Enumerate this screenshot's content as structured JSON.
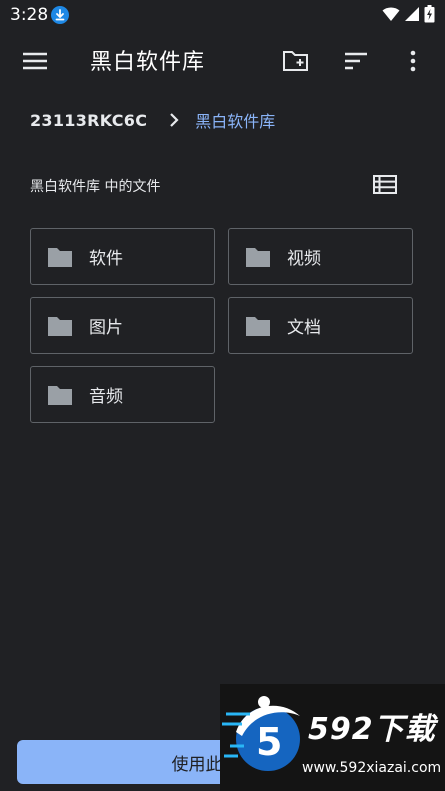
{
  "status_bar": {
    "time": "3:28",
    "icons": [
      "download-icon",
      "wifi-icon",
      "signal-icon",
      "battery-icon"
    ]
  },
  "app_bar": {
    "title": "黑白软件库",
    "icons": [
      "menu-icon",
      "new-folder-icon",
      "sort-icon",
      "more-vert-icon"
    ]
  },
  "breadcrumb": {
    "root": "23113RKC6C",
    "current": "黑白软件库"
  },
  "section": {
    "title": "黑白软件库 中的文件"
  },
  "folders": [
    {
      "label": "软件"
    },
    {
      "label": "视频"
    },
    {
      "label": "图片"
    },
    {
      "label": "文档"
    },
    {
      "label": "音频"
    }
  ],
  "bottom": {
    "button_label": "使用此"
  },
  "watermark": {
    "brand": "592下载",
    "logo_digit": "5",
    "url": "www.592xiazai.com"
  },
  "colors": {
    "background": "#202124",
    "accent": "#8ab4f8",
    "border": "#5f6368",
    "folder": "#9aa0a6"
  }
}
